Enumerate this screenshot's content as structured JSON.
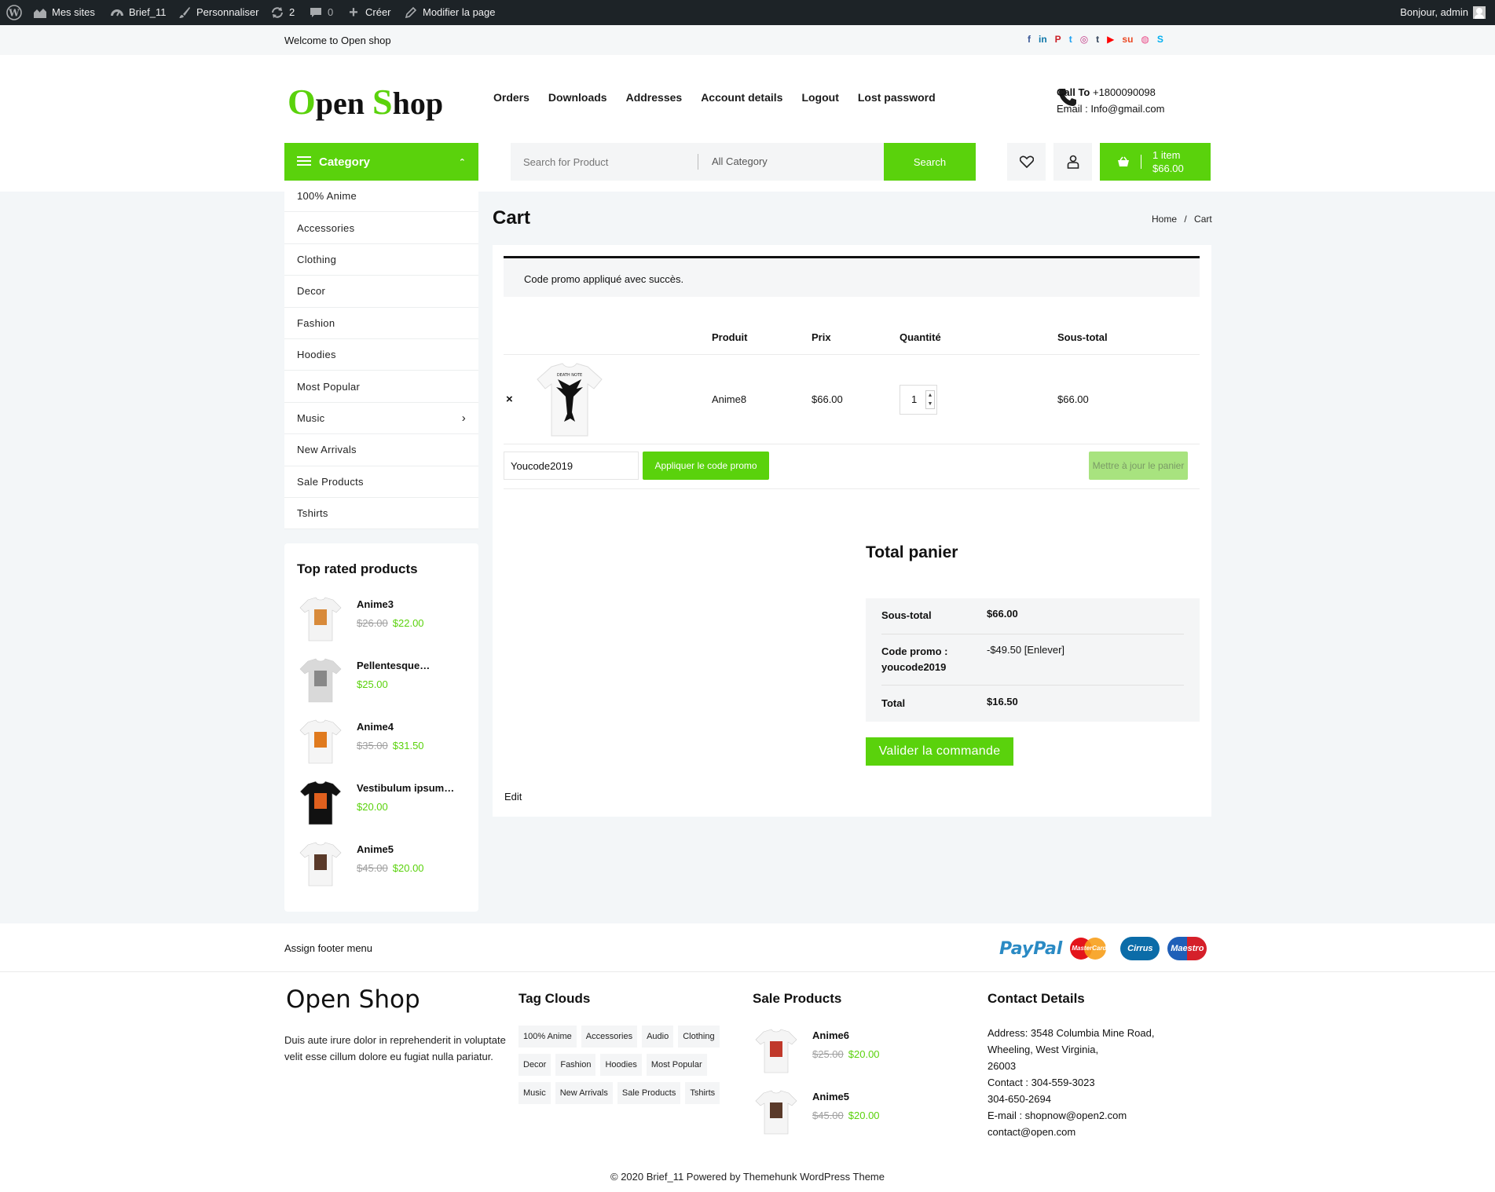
{
  "adminbar": {
    "mes_sites": "Mes sites",
    "site": "Brief_11",
    "customize": "Personnaliser",
    "updates": "2",
    "comments": "0",
    "create": "Créer",
    "edit_page": "Modifier la page",
    "greeting": "Bonjour, admin"
  },
  "topbar": {
    "welcome": "Welcome to Open shop",
    "social": [
      {
        "icon": "facebook-icon",
        "glyph": "f",
        "color": "#3b5998"
      },
      {
        "icon": "linkedin-icon",
        "glyph": "in",
        "color": "#0e76a8"
      },
      {
        "icon": "pinterest-icon",
        "glyph": "P",
        "color": "#cb2027"
      },
      {
        "icon": "twitter-icon",
        "glyph": "t",
        "color": "#1da1f2"
      },
      {
        "icon": "instagram-icon",
        "glyph": "◎",
        "color": "#c13584"
      },
      {
        "icon": "tumblr-icon",
        "glyph": "t",
        "color": "#35465c"
      },
      {
        "icon": "youtube-icon",
        "glyph": "▶",
        "color": "#ff0000"
      },
      {
        "icon": "stumbleupon-icon",
        "glyph": "su",
        "color": "#eb4924"
      },
      {
        "icon": "dribbble-icon",
        "glyph": "◍",
        "color": "#ea4c89"
      },
      {
        "icon": "skype-icon",
        "glyph": "S",
        "color": "#00aff0"
      }
    ]
  },
  "header": {
    "logo_o": "O",
    "logo_pen": "pen ",
    "logo_s": "S",
    "logo_hop": "hop",
    "nav": [
      "Orders",
      "Downloads",
      "Addresses",
      "Account details",
      "Logout",
      "Lost password"
    ],
    "call_label": "Call To",
    "call_number": " +1800090098",
    "email_line": "Email : Info@gmail.com",
    "category_label": "Category",
    "search_placeholder": "Search for Product",
    "all_category": "All Category",
    "search_button": "Search",
    "cart_items": "1 item",
    "cart_total": "$66.00"
  },
  "colors": {
    "accent": "#5ad20c",
    "dark": "#1d2327"
  },
  "categories": [
    {
      "label": "100% Anime"
    },
    {
      "label": "Accessories"
    },
    {
      "label": "Clothing"
    },
    {
      "label": "Decor"
    },
    {
      "label": "Fashion"
    },
    {
      "label": "Hoodies"
    },
    {
      "label": "Most Popular"
    },
    {
      "label": "Music",
      "submenu": "›"
    },
    {
      "label": "New Arrivals"
    },
    {
      "label": "Sale Products"
    },
    {
      "label": "Tshirts"
    }
  ],
  "top_rated": {
    "title": "Top rated products",
    "items": [
      {
        "name": "Anime3",
        "old": "$26.00",
        "price": "$22.00"
      },
      {
        "name": "Pellentesque…",
        "old": "",
        "price": "$25.00"
      },
      {
        "name": "Anime4",
        "old": "$35.00",
        "price": "$31.50"
      },
      {
        "name": "Vestibulum ipsum…",
        "old": "",
        "price": "$20.00"
      },
      {
        "name": "Anime5",
        "old": "$45.00",
        "price": "$20.00"
      }
    ]
  },
  "page": {
    "title": "Cart",
    "breadcrumb_home": "Home",
    "breadcrumb_sep": "/",
    "breadcrumb_current": "Cart",
    "notice": "Code promo appliqué avec succès."
  },
  "cart": {
    "headers": {
      "product": "Produit",
      "price": "Prix",
      "quantity": "Quantité",
      "subtotal": "Sous-total"
    },
    "row": {
      "remove": "×",
      "name": "Anime8",
      "price": "$66.00",
      "qty": "1",
      "subtotal": "$66.00"
    },
    "coupon_value": "Youcode2019",
    "apply_label": "Appliquer le code promo",
    "update_label": "Mettre à jour le panier"
  },
  "totals": {
    "title": "Total panier",
    "subtotal_label": "Sous-total",
    "subtotal_value": "$66.00",
    "promo_label_1": "Code promo :",
    "promo_label_2": "youcode2019",
    "promo_value": "-$49.50",
    "promo_remove": "[Enlever]",
    "total_label": "Total",
    "total_value": "$16.50",
    "checkout_label": "Valider la commande"
  },
  "edit_label": "Edit",
  "footer": {
    "menu": "Assign footer menu",
    "payments": [
      "PayPal",
      "MasterCard",
      "Cirrus",
      "Maestro"
    ],
    "brand": "Open Shop",
    "description": "Duis aute irure dolor in reprehenderit in voluptate velit esse cillum dolore eu fugiat nulla pariatur.",
    "tags_title": "Tag Clouds",
    "tags": [
      "100% Anime",
      "Accessories",
      "Audio",
      "Clothing",
      "Decor",
      "Fashion",
      "Hoodies",
      "Most Popular",
      "Music",
      "New Arrivals",
      "Sale Products",
      "Tshirts"
    ],
    "sale_title": "Sale Products",
    "sale_items": [
      {
        "name": "Anime6",
        "old": "$25.00",
        "price": "$20.00"
      },
      {
        "name": "Anime5",
        "old": "$45.00",
        "price": "$20.00"
      }
    ],
    "contact_title": "Contact Details",
    "contact_lines": [
      "Address: 3548 Columbia Mine Road,",
      "Wheeling, West Virginia,",
      "26003",
      "Contact : 304-559-3023",
      "304-650-2694",
      "E-mail : shopnow@open2.com",
      "contact@open.com"
    ],
    "copyright": "© 2020 Brief_11 Powered by Themehunk WordPress Theme"
  }
}
